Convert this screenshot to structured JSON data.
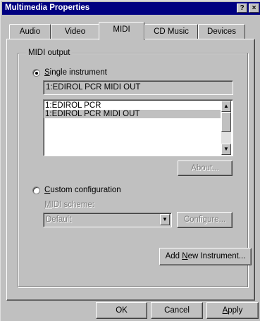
{
  "window": {
    "title": "Multimedia Properties",
    "help_glyph": "?",
    "close_glyph": "×"
  },
  "tabs": [
    {
      "label": "Audio"
    },
    {
      "label": "Video"
    },
    {
      "label": "MIDI"
    },
    {
      "label": "CD Music"
    },
    {
      "label": "Devices"
    }
  ],
  "active_tab": "MIDI",
  "midi_output": {
    "group_label": "MIDI output",
    "single_instrument": {
      "label_underlined": "S",
      "label_rest": "ingle instrument",
      "selected": true,
      "current_value": "1:EDIROL PCR MIDI OUT",
      "list_items": [
        "1:EDIROL PCR",
        "1:EDIROL PCR MIDI OUT"
      ],
      "selected_item": "1:EDIROL PCR MIDI OUT",
      "about_button": "About..."
    },
    "custom_configuration": {
      "label_underlined": "C",
      "label_rest": "ustom configuration",
      "selected": false,
      "scheme_label_underlined": "M",
      "scheme_label_rest": "IDI scheme:",
      "scheme_value": "Default",
      "configure_button": "Configure..."
    },
    "add_new_instrument": {
      "before": "Add ",
      "underlined": "N",
      "after": "ew Instrument..."
    }
  },
  "footer": {
    "ok": "OK",
    "cancel": "Cancel",
    "apply_underlined": "A",
    "apply_rest": "pply"
  },
  "icons": {
    "arrow_up": "▲",
    "arrow_down": "▼"
  }
}
